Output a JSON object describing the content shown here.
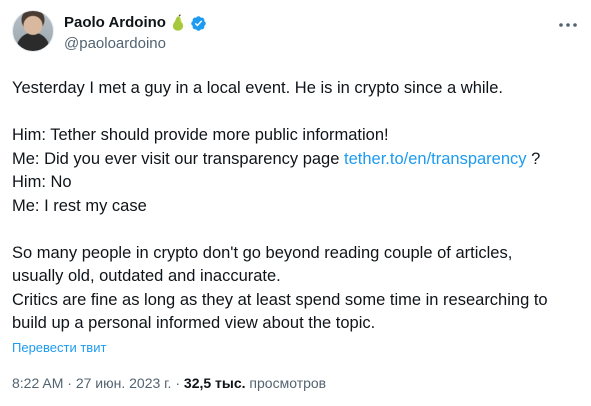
{
  "author": {
    "name": "Paolo Ardoino",
    "handle": "@paoloardoino",
    "name_emoji": "pear-icon",
    "verified_badge": "verified-icon",
    "badge_color": "#1d9bf0"
  },
  "more_icon": "ellipsis-icon",
  "tweet": {
    "para1": {
      "line1": "Yesterday I met a guy in a local event. He is in crypto since a while."
    },
    "para2": {
      "line1": "Him: Tether should provide more public information!",
      "line2_prefix": "Me: Did you ever visit our transparency page ",
      "line2_link": "tether.to/en/transparency",
      "line2_suffix": " ?",
      "line3": "Him: No",
      "line4": "Me: I rest my case"
    },
    "para3": {
      "line1": "So many people in crypto don't go beyond reading couple of articles,",
      "line2": "usually old, outdated and inaccurate.",
      "line3": "Critics are fine as long as they at least spend some time in researching to",
      "line4": "build up a personal informed view about the topic."
    }
  },
  "translate_label": "Перевести твит",
  "meta": {
    "time": "8:22 AM",
    "separator1": " · ",
    "date": "27 июн. 2023 г.",
    "separator2": " · ",
    "views_count": "32,5 тыс.",
    "views_label": " просмотров"
  },
  "colors": {
    "link": "#1d9bf0",
    "secondary_text": "#536471",
    "primary_text": "#0f1419"
  }
}
